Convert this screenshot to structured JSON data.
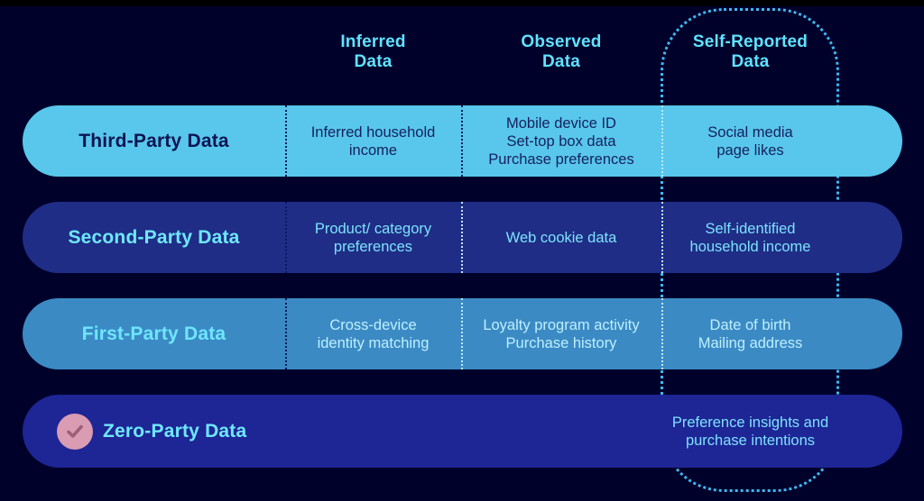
{
  "theme": {
    "background": "#00012B",
    "accent_cyan": "#6EE8FF",
    "highlight_border": "#3FB8F0",
    "badge_fill": "#D99CB2",
    "badge_check": "#9E5E77",
    "row_colors": [
      "#58C7EB",
      "#1F2D86",
      "#3B8AC4",
      "#1E2595"
    ]
  },
  "columns": [
    {
      "id": "label",
      "line1": "",
      "line2": ""
    },
    {
      "id": "inferred",
      "line1": "Inferred",
      "line2": "Data"
    },
    {
      "id": "observed",
      "line1": "Observed",
      "line2": "Data"
    },
    {
      "id": "self",
      "line1": "Self-Reported",
      "line2": "Data"
    }
  ],
  "highlight": {
    "column": "Self-Reported Data"
  },
  "rows": [
    {
      "id": "third-party",
      "label": "Third-Party Data",
      "inferred": "Inferred household\nincome",
      "observed": "Mobile device ID\nSet-top box data\nPurchase preferences",
      "self_reported": "Social media\npage likes",
      "has_check": false
    },
    {
      "id": "second-party",
      "label": "Second-Party Data",
      "inferred": "Product/ category\npreferences",
      "observed": "Web cookie data",
      "self_reported": "Self-identified\nhousehold income",
      "has_check": false
    },
    {
      "id": "first-party",
      "label": "First-Party Data",
      "inferred": "Cross-device\nidentity matching",
      "observed": "Loyalty program activity\nPurchase history",
      "self_reported": "Date of birth\nMailing address",
      "has_check": false
    },
    {
      "id": "zero-party",
      "label": "Zero-Party Data",
      "inferred": "",
      "observed": "",
      "self_reported": "Preference insights and\npurchase intentions",
      "has_check": true
    }
  ]
}
